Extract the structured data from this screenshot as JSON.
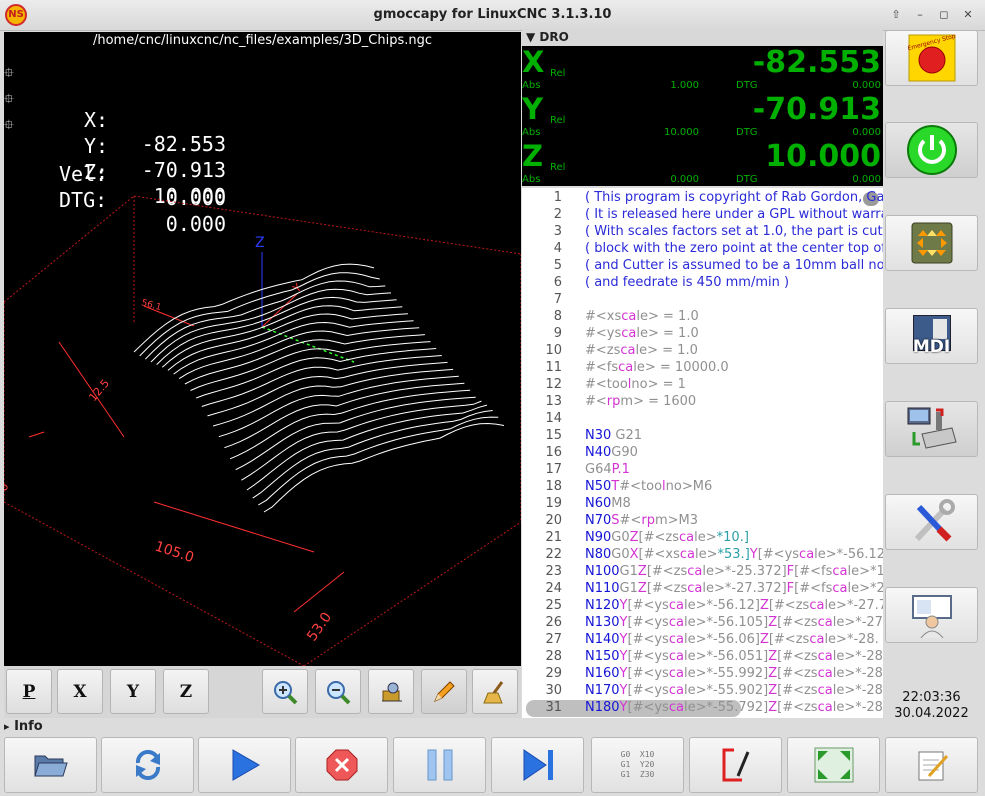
{
  "window": {
    "title": "gmoccapy for LinuxCNC  3.1.3.10",
    "app_icon": "NS"
  },
  "window_buttons": [
    "⇧",
    "–",
    "◻",
    "✕"
  ],
  "preview": {
    "file_path": "/home/cnc/linuxcnc/nc_files/examples/3D_Chips.ngc",
    "dro": [
      {
        "label": "X:",
        "value": "-82.553",
        "marker": true
      },
      {
        "label": "Y:",
        "value": "-70.913",
        "marker": true
      },
      {
        "label": "Z:",
        "value": "10.000",
        "marker": true
      },
      {
        "label": "Vel:",
        "value": "0.000",
        "marker": false
      },
      {
        "label": "DTG:",
        "value": "0.000",
        "marker": false
      }
    ],
    "dim_labels": {
      "z_height": "56.1",
      "y_depth": "12.5",
      "x_width": "105.0",
      "y_width": "53.0",
      "left_edge": "0"
    },
    "axis_labels": {
      "z": "Z",
      "y": "Y"
    }
  },
  "view_buttons": [
    {
      "name": "view-p-button",
      "label": "P"
    },
    {
      "name": "view-x-button",
      "label": "X"
    },
    {
      "name": "view-y-button",
      "label": "Y"
    },
    {
      "name": "view-z-button",
      "label": "Z"
    }
  ],
  "dro_panel": {
    "header": "▼ DRO",
    "axes": [
      {
        "axis": "X",
        "rel": "Rel",
        "value": "-82.553",
        "abs_label": "Abs",
        "abs": "1.000",
        "dtg_label": "DTG",
        "dtg": "0.000"
      },
      {
        "axis": "Y",
        "rel": "Rel",
        "value": "-70.913",
        "abs_label": "Abs",
        "abs": "10.000",
        "dtg_label": "DTG",
        "dtg": "0.000"
      },
      {
        "axis": "Z",
        "rel": "Rel",
        "value": "10.000",
        "abs_label": "Abs",
        "abs": "0.000",
        "dtg_label": "DTG",
        "dtg": "0.000"
      }
    ]
  },
  "gcode": {
    "current_line": 31,
    "lines": [
      {
        "n": "1",
        "segs": [
          [
            "( This program is copyright of Rab Gordon, Ga",
            "c-comment"
          ]
        ]
      },
      {
        "n": "2",
        "segs": [
          [
            "( It is released here under a GPL without warra",
            "c-comment"
          ]
        ]
      },
      {
        "n": "3",
        "segs": [
          [
            "( With scales factors set at 1.0, the part is cut",
            "c-comment"
          ]
        ]
      },
      {
        "n": "4",
        "segs": [
          [
            "( block with the zero point at the center top of",
            "c-comment"
          ]
        ]
      },
      {
        "n": "5",
        "segs": [
          [
            "( and Cutter is assumed to be a 10mm ball no",
            "c-comment"
          ]
        ]
      },
      {
        "n": "6",
        "segs": [
          [
            "( and feedrate is 450 mm/min )",
            "c-comment"
          ]
        ]
      },
      {
        "n": "7",
        "segs": []
      },
      {
        "n": "8",
        "segs": [
          [
            "#<xs",
            "c-param"
          ],
          [
            "ca",
            "c-kw"
          ],
          [
            "le> = 1.0",
            "c-param"
          ]
        ]
      },
      {
        "n": "9",
        "segs": [
          [
            "#<ys",
            "c-param"
          ],
          [
            "ca",
            "c-kw"
          ],
          [
            "le> = 1.0",
            "c-param"
          ]
        ]
      },
      {
        "n": "10",
        "segs": [
          [
            "#<zs",
            "c-param"
          ],
          [
            "ca",
            "c-kw"
          ],
          [
            "le> = 1.0",
            "c-param"
          ]
        ]
      },
      {
        "n": "11",
        "segs": [
          [
            "#<fs",
            "c-param"
          ],
          [
            "ca",
            "c-kw"
          ],
          [
            "le> = 10000.0",
            "c-param"
          ]
        ]
      },
      {
        "n": "12",
        "segs": [
          [
            "#<too",
            "c-param"
          ],
          [
            "l",
            "c-kw"
          ],
          [
            "no> = 1",
            "c-param"
          ]
        ]
      },
      {
        "n": "13",
        "segs": [
          [
            "#<",
            "c-param"
          ],
          [
            "rp",
            "c-kw"
          ],
          [
            "m>    = 1600",
            "c-param"
          ]
        ]
      },
      {
        "n": "14",
        "segs": []
      },
      {
        "n": "15",
        "segs": [
          [
            "N30 ",
            "c-n"
          ],
          [
            "G21",
            "c-g"
          ]
        ]
      },
      {
        "n": "16",
        "segs": [
          [
            "N40",
            "c-n"
          ],
          [
            "G90",
            "c-g"
          ]
        ]
      },
      {
        "n": "17",
        "segs": [
          [
            "G64",
            "c-g"
          ],
          [
            "P.1",
            "c-letter"
          ]
        ]
      },
      {
        "n": "18",
        "segs": [
          [
            "N50",
            "c-n"
          ],
          [
            "T",
            "c-letter"
          ],
          [
            "#<too",
            "c-var"
          ],
          [
            "l",
            "c-kw"
          ],
          [
            "no>M6",
            "c-var"
          ]
        ]
      },
      {
        "n": "19",
        "segs": [
          [
            "N60",
            "c-n"
          ],
          [
            "M8",
            "c-g"
          ]
        ]
      },
      {
        "n": "20",
        "segs": [
          [
            "N70",
            "c-n"
          ],
          [
            "S",
            "c-letter"
          ],
          [
            "#<",
            "c-var"
          ],
          [
            "rp",
            "c-kw"
          ],
          [
            "m>M3",
            "c-var"
          ]
        ]
      },
      {
        "n": "21",
        "segs": [
          [
            "N90",
            "c-n"
          ],
          [
            "G0",
            "c-g"
          ],
          [
            "Z",
            "c-letter"
          ],
          [
            "[#<zs",
            "c-var"
          ],
          [
            "ca",
            "c-kw"
          ],
          [
            "le>",
            "c-var"
          ],
          [
            "*10.]",
            "c-teal"
          ]
        ]
      },
      {
        "n": "22",
        "segs": [
          [
            "N80",
            "c-n"
          ],
          [
            "G0",
            "c-g"
          ],
          [
            "X",
            "c-letter"
          ],
          [
            "[#<xs",
            "c-var"
          ],
          [
            "ca",
            "c-kw"
          ],
          [
            "le>",
            "c-var"
          ],
          [
            "*53.]",
            "c-teal"
          ],
          [
            "Y",
            "c-letter"
          ],
          [
            "[#<ys",
            "c-var"
          ],
          [
            "ca",
            "c-kw"
          ],
          [
            "le>*-56.12",
            "c-var"
          ]
        ]
      },
      {
        "n": "23",
        "segs": [
          [
            "N100",
            "c-n"
          ],
          [
            "G1",
            "c-g"
          ],
          [
            "Z",
            "c-letter"
          ],
          [
            "[#<zs",
            "c-var"
          ],
          [
            "ca",
            "c-kw"
          ],
          [
            "le>*-25.372]",
            "c-var"
          ],
          [
            "F",
            "c-letter"
          ],
          [
            "[#<fs",
            "c-var"
          ],
          [
            "ca",
            "c-kw"
          ],
          [
            "le>*1",
            "c-var"
          ]
        ]
      },
      {
        "n": "24",
        "segs": [
          [
            "N110",
            "c-n"
          ],
          [
            "G1",
            "c-g"
          ],
          [
            "Z",
            "c-letter"
          ],
          [
            "[#<zs",
            "c-var"
          ],
          [
            "ca",
            "c-kw"
          ],
          [
            "le>*-27.372]",
            "c-var"
          ],
          [
            "F",
            "c-letter"
          ],
          [
            "[#<fs",
            "c-var"
          ],
          [
            "ca",
            "c-kw"
          ],
          [
            "le>*2",
            "c-var"
          ]
        ]
      },
      {
        "n": "25",
        "segs": [
          [
            "N120",
            "c-n"
          ],
          [
            "Y",
            "c-letter"
          ],
          [
            "[#<ys",
            "c-var"
          ],
          [
            "ca",
            "c-kw"
          ],
          [
            "le>*-56.12]",
            "c-var"
          ],
          [
            "Z",
            "c-letter"
          ],
          [
            "[#<zs",
            "c-var"
          ],
          [
            "ca",
            "c-kw"
          ],
          [
            "le>*-27.7",
            "c-var"
          ]
        ]
      },
      {
        "n": "26",
        "segs": [
          [
            "N130",
            "c-n"
          ],
          [
            "Y",
            "c-letter"
          ],
          [
            "[#<ys",
            "c-var"
          ],
          [
            "ca",
            "c-kw"
          ],
          [
            "le>*-56.105]",
            "c-var"
          ],
          [
            "Z",
            "c-letter"
          ],
          [
            "[#<zs",
            "c-var"
          ],
          [
            "ca",
            "c-kw"
          ],
          [
            "le>*-27",
            "c-var"
          ]
        ]
      },
      {
        "n": "27",
        "segs": [
          [
            "N140",
            "c-n"
          ],
          [
            "Y",
            "c-letter"
          ],
          [
            "[#<ys",
            "c-var"
          ],
          [
            "ca",
            "c-kw"
          ],
          [
            "le>*-56.06]",
            "c-var"
          ],
          [
            "Z",
            "c-letter"
          ],
          [
            "[#<zs",
            "c-var"
          ],
          [
            "ca",
            "c-kw"
          ],
          [
            "le>*-28.",
            "c-var"
          ]
        ]
      },
      {
        "n": "28",
        "segs": [
          [
            "N150",
            "c-n"
          ],
          [
            "Y",
            "c-letter"
          ],
          [
            "[#<ys",
            "c-var"
          ],
          [
            "ca",
            "c-kw"
          ],
          [
            "le>*-56.051]",
            "c-var"
          ],
          [
            "Z",
            "c-letter"
          ],
          [
            "[#<zs",
            "c-var"
          ],
          [
            "ca",
            "c-kw"
          ],
          [
            "le>*-28",
            "c-var"
          ]
        ]
      },
      {
        "n": "29",
        "segs": [
          [
            "N160",
            "c-n"
          ],
          [
            "Y",
            "c-letter"
          ],
          [
            "[#<ys",
            "c-var"
          ],
          [
            "ca",
            "c-kw"
          ],
          [
            "le>*-55.992]",
            "c-var"
          ],
          [
            "Z",
            "c-letter"
          ],
          [
            "[#<zs",
            "c-var"
          ],
          [
            "ca",
            "c-kw"
          ],
          [
            "le>*-28",
            "c-var"
          ]
        ]
      },
      {
        "n": "30",
        "segs": [
          [
            "N170",
            "c-n"
          ],
          [
            "Y",
            "c-letter"
          ],
          [
            "[#<ys",
            "c-var"
          ],
          [
            "ca",
            "c-kw"
          ],
          [
            "le>*-55.902]",
            "c-var"
          ],
          [
            "Z",
            "c-letter"
          ],
          [
            "[#<zs",
            "c-var"
          ],
          [
            "ca",
            "c-kw"
          ],
          [
            "le>*-28",
            "c-var"
          ]
        ]
      },
      {
        "n": "31",
        "segs": [
          [
            "N180",
            "c-n"
          ],
          [
            "Y",
            "c-letter"
          ],
          [
            "[#<ys",
            "c-var"
          ],
          [
            "ca",
            "c-kw"
          ],
          [
            "le>*-55.792]",
            "c-var"
          ],
          [
            "Z",
            "c-letter"
          ],
          [
            "[#<zs",
            "c-var"
          ],
          [
            "ca",
            "c-kw"
          ],
          [
            "le>*-28",
            "c-var"
          ]
        ]
      }
    ]
  },
  "side_buttons": [
    {
      "name": "estop-button",
      "icon": "emergency-stop-icon",
      "caption": "Emergency Stop"
    },
    {
      "name": "machine-power-button",
      "icon": "power-icon"
    },
    {
      "name": "manual-mode-button",
      "icon": "jog-arrows-icon"
    },
    {
      "name": "mdi-mode-button",
      "icon": "mdi-icon",
      "label": "MDI"
    },
    {
      "name": "auto-mode-button",
      "icon": "cnc-machine-icon"
    },
    {
      "name": "settings-button",
      "icon": "tools-icon"
    },
    {
      "name": "user-tabs-button",
      "icon": "user-screen-icon"
    }
  ],
  "clock": {
    "time": "22:03:36",
    "date": "30.04.2022"
  },
  "info": {
    "label": "Info",
    "arrow": "▸"
  },
  "gcode_button_text": "G0  X10\nG1  Y20\nG1  Z30",
  "colors": {
    "dro_green": "#00b000",
    "preview_bg": "#000000",
    "toolpath": "#ffffff",
    "limits": "#ff2020"
  }
}
